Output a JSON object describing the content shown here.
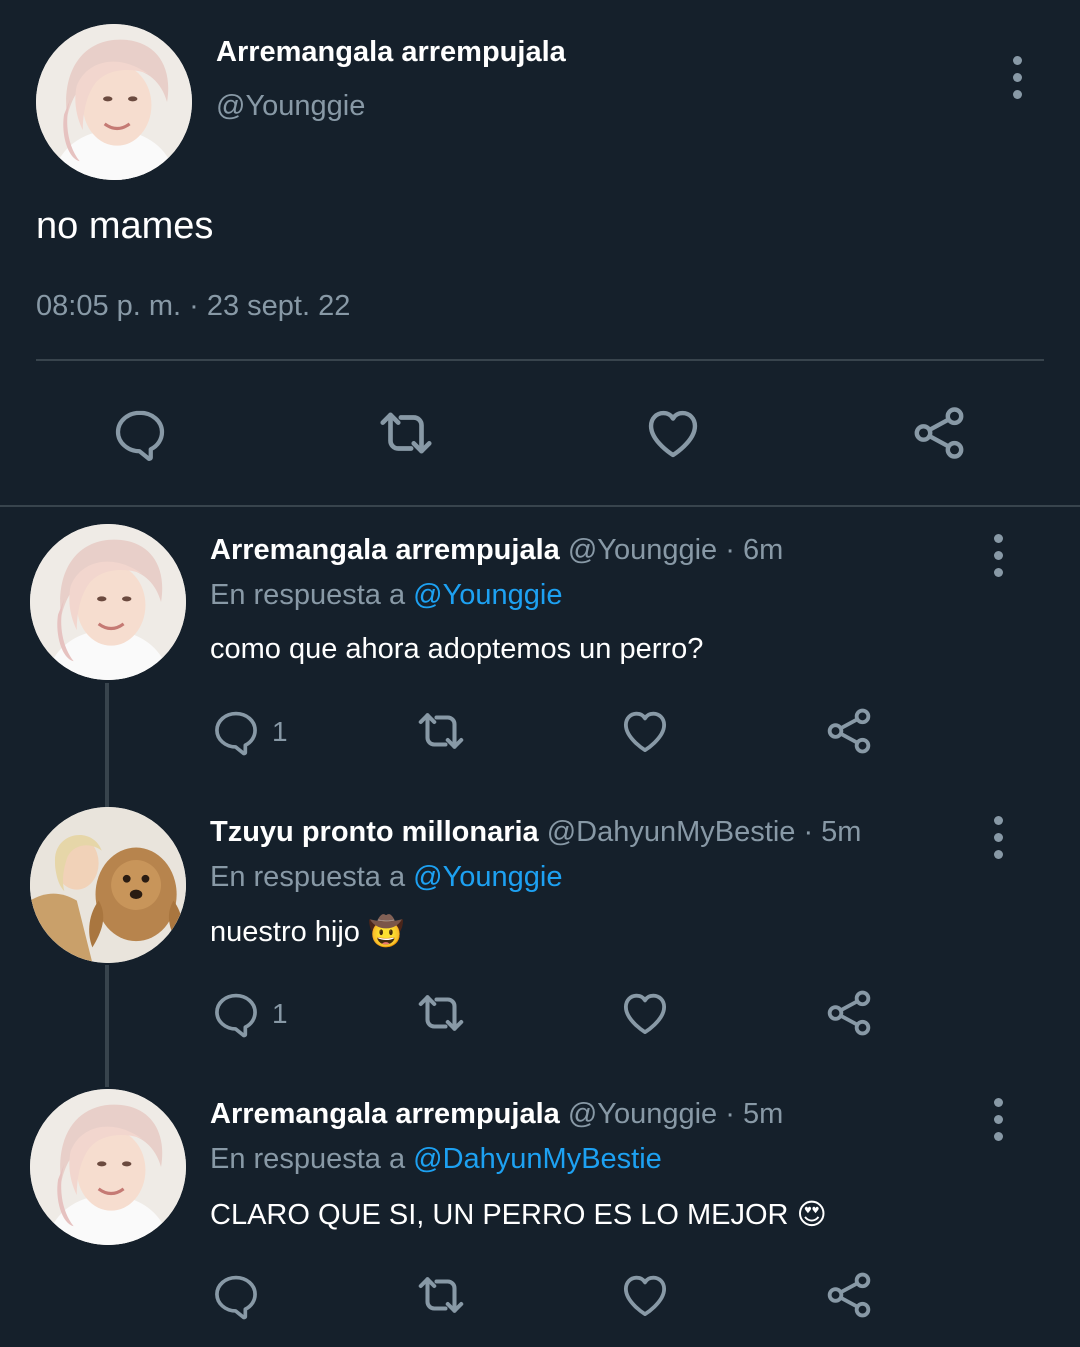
{
  "main_tweet": {
    "display_name": "Arremangala arrempujala",
    "handle": "@Younggie",
    "text": "no mames",
    "timestamp": "08:05 p. m. · 23 sept. 22",
    "actions": [
      "reply-icon",
      "retweet-icon",
      "like-icon",
      "share-icon"
    ]
  },
  "replies": [
    {
      "display_name": "Arremangala arrempujala",
      "handle_time": "@Younggie · 6m",
      "reply_prefix": "En respuesta a",
      "reply_to": "@Younggie",
      "text": "como que ahora adoptemos un perro?",
      "reply_count": "1"
    },
    {
      "display_name": "Tzuyu pronto millonaria",
      "handle_time": "@DahyunMyBestie · 5m",
      "reply_prefix": "En respuesta a",
      "reply_to": "@Younggie",
      "text": "nuestro hijo",
      "emoji": "🤠",
      "reply_count": "1"
    },
    {
      "display_name": "Arremangala arrempujala",
      "handle_time": "@Younggie · 5m",
      "reply_prefix": "En respuesta a",
      "reply_to": "@DahyunMyBestie",
      "text": "CLARO QUE SI, UN PERRO ES LO MEJOR",
      "emoji": "😍",
      "reply_count": ""
    }
  ],
  "colors": {
    "background": "#15202b",
    "muted": "#8899a6",
    "link": "#1da1f2",
    "divider": "#38444d"
  }
}
